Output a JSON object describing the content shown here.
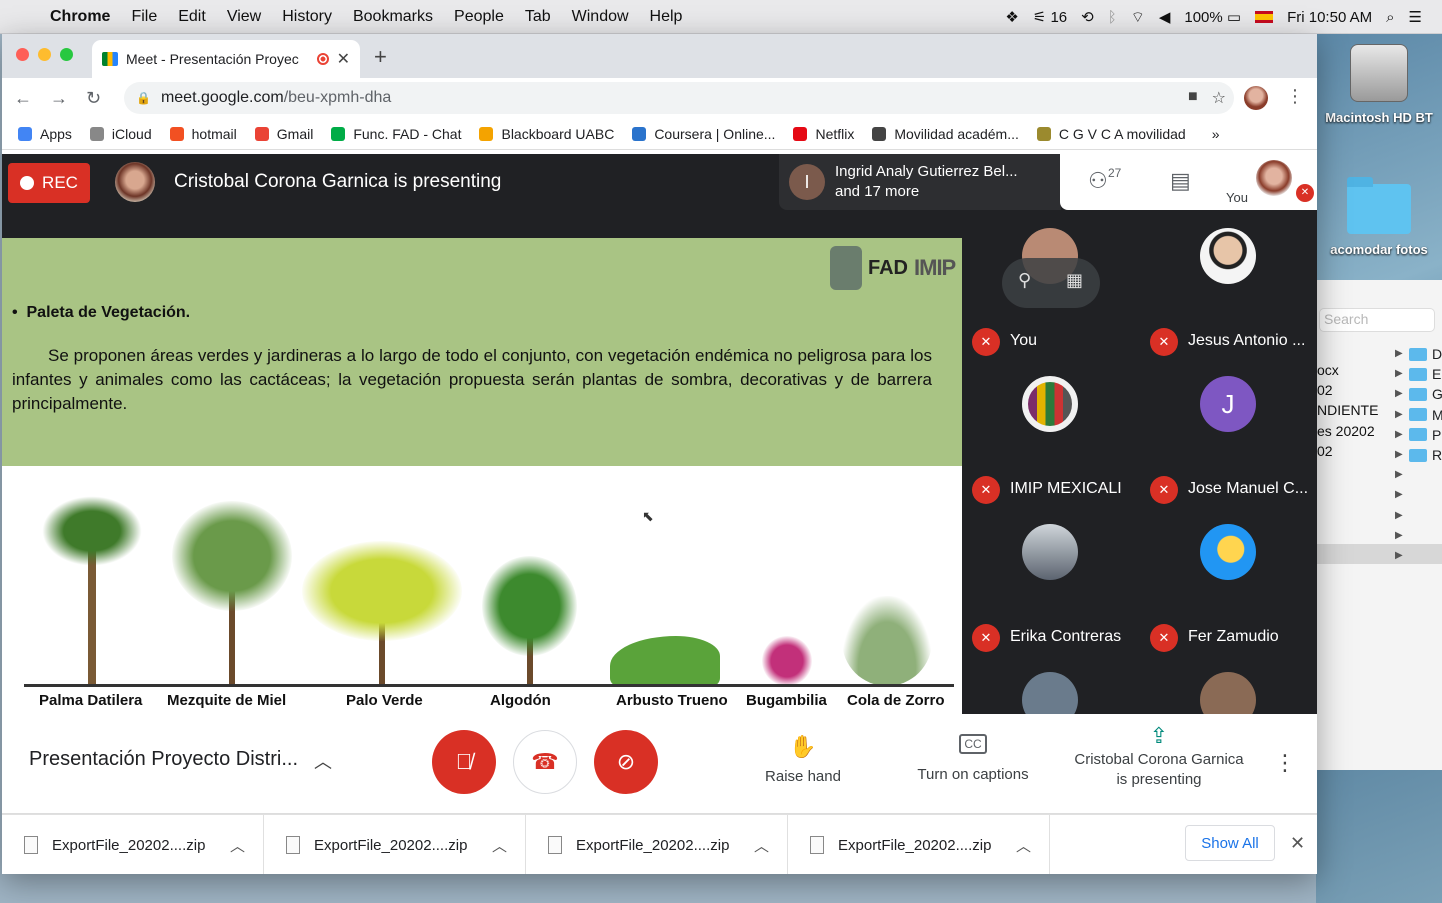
{
  "menubar": {
    "app": "Chrome",
    "items": [
      "File",
      "Edit",
      "View",
      "History",
      "Bookmarks",
      "People",
      "Tab",
      "Window",
      "Help"
    ],
    "status": {
      "adobe_count": "16",
      "battery": "100%",
      "clock": "Fri 10:50 AM"
    }
  },
  "desktop": {
    "hd_label": "Macintosh HD BT",
    "folder_label": "acomodar fotos"
  },
  "finder": {
    "search_placeholder": "Search",
    "left_items": [
      "ocx",
      "02",
      "",
      "NDIENTE",
      "es 20202",
      "02"
    ],
    "right_items": [
      "D",
      "E",
      "G",
      "M",
      "P",
      "R"
    ]
  },
  "tab": {
    "title": "Meet - Presentación Proyec"
  },
  "omnibox": {
    "host": "meet.google.com",
    "path": "/beu-xpmh-dha"
  },
  "bookmarks": [
    {
      "label": "Apps",
      "color": "#4285f4"
    },
    {
      "label": "iCloud",
      "color": "#888888"
    },
    {
      "label": "hotmail",
      "color": "#f25022"
    },
    {
      "label": "Gmail",
      "color": "#ea4335"
    },
    {
      "label": "Func. FAD - Chat",
      "color": "#00ac47"
    },
    {
      "label": "Blackboard UABC",
      "color": "#f4a300"
    },
    {
      "label": "Coursera | Online...",
      "color": "#2a73cc"
    },
    {
      "label": "Netflix",
      "color": "#e50914"
    },
    {
      "label": "Movilidad académ...",
      "color": "#444444"
    },
    {
      "label": "C G V C A movilidad",
      "color": "#9b8a2e"
    }
  ],
  "bookmarks_more": "»",
  "meet": {
    "rec_label": "REC",
    "presenting_text": "Cristobal Corona Garnica is presenting",
    "pill_initial": "I",
    "pill_line1": "Ingrid Analy Gutierrez Bel...",
    "pill_line2": "and 17 more",
    "people_count": "27",
    "you_label": "You"
  },
  "slide": {
    "logo_fad": "FAD",
    "logo_imip": "IMIP",
    "heading": "Paleta de Vegetación.",
    "bullet": "•",
    "body": "Se proponen áreas verdes y jardineras a lo largo de todo el conjunto, con vegetación endémica no peligrosa para los infantes y animales como las cactáceas; la vegetación propuesta serán plantas de sombra, decorativas y de barrera principalmente.",
    "plants": [
      "Palma Datilera",
      "Mezquite de Miel",
      "Palo Verde",
      "Algodón",
      "Arbusto Trueno",
      "Bugambilia",
      "Cola de Zorro"
    ]
  },
  "participants": [
    {
      "name": "You",
      "color": "#b98a74"
    },
    {
      "name": "Jesus Antonio ...",
      "color": "#d9d9d9"
    },
    {
      "name": "IMIP MEXICALI",
      "color": "#f1f1f1"
    },
    {
      "name": "Jose Manuel C...",
      "color": "#7e57c2",
      "initial": "J"
    },
    {
      "name": "Erika Contreras",
      "color": "#8a8d91"
    },
    {
      "name": "Fer Zamudio",
      "color": "#2196f3"
    }
  ],
  "controls": {
    "meeting_title": "Presentación Proyecto Distri...",
    "raise_hand": "Raise hand",
    "captions": "Turn on captions",
    "presenting_line1": "Cristobal Corona Garnica",
    "presenting_line2": "is presenting"
  },
  "downloads": {
    "files": [
      "ExportFile_20202....zip",
      "ExportFile_20202....zip",
      "ExportFile_20202....zip",
      "ExportFile_20202....zip"
    ],
    "show_all": "Show All"
  }
}
